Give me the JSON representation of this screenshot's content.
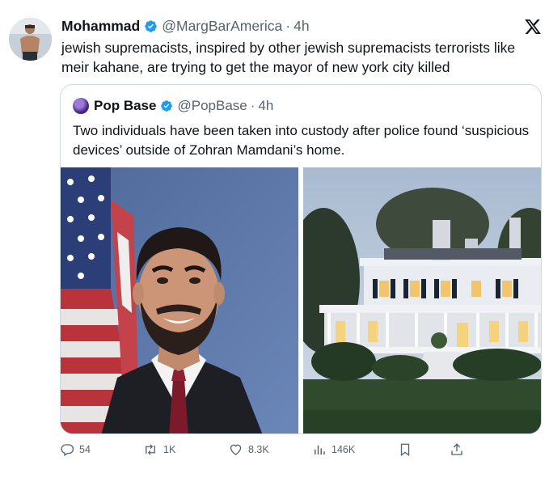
{
  "tweet": {
    "author_name": "Mohammad",
    "author_handle": "@MargBarAmerica",
    "separator": "·",
    "time": "4h",
    "text": "jewish supremacists, inspired by other jewish supremacists terrorists like meir kahane, are trying to get the mayor of new york city killed"
  },
  "quote": {
    "author_name": "Pop Base",
    "author_handle": "@PopBase",
    "separator": "·",
    "time": "4h",
    "text": "Two individuals have been taken into custody after police found ‘suspicious devices’ outside of Zohran Mamdani’s home."
  },
  "actions": {
    "replies": "54",
    "reposts": "1K",
    "likes": "8.3K",
    "views": "146K"
  },
  "icons": {
    "verified": "verified-badge-icon",
    "x_logo": "x-logo-icon",
    "reply": "reply-icon",
    "repost": "repost-icon",
    "like": "heart-icon",
    "views": "views-icon",
    "bookmark": "bookmark-icon",
    "share": "share-icon"
  },
  "colors": {
    "text": "#0f1419",
    "muted": "#536471",
    "verified": "#1d9bf0",
    "border": "#cfd9de"
  }
}
